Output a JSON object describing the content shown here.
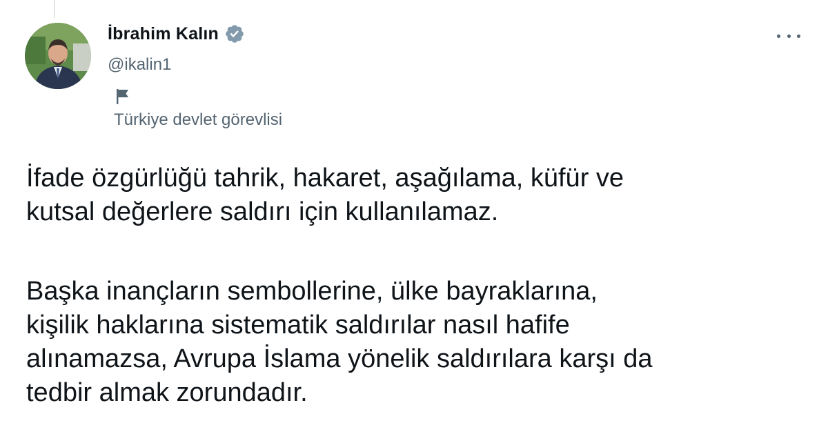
{
  "author": {
    "name": "İbrahim Kalın",
    "handle": "@ikalin1",
    "verified_icon": "verified-badge-icon",
    "label_icon": "flag-icon",
    "label": "Türkiye devlet görevlisi"
  },
  "menu": {
    "more_icon": "more-options-icon"
  },
  "tweet": {
    "paragraph1": [
      "İfade özgürlüğü tahrik, hakaret, aşağılama, küfür ve",
      "kutsal değerlere saldırı için kullanılamaz."
    ],
    "paragraph2": [
      "Başka inançların sembollerine, ülke bayraklarına,",
      "kişilik haklarına sistematik saldırılar nasıl hafife",
      "alınamazsa, Avrupa İslama yönelik saldırılara karşı da",
      "tedbir almak zorundadır."
    ]
  },
  "colors": {
    "text_primary": "#0f1419",
    "text_secondary": "#536471",
    "verified_badge": "#829aab"
  }
}
